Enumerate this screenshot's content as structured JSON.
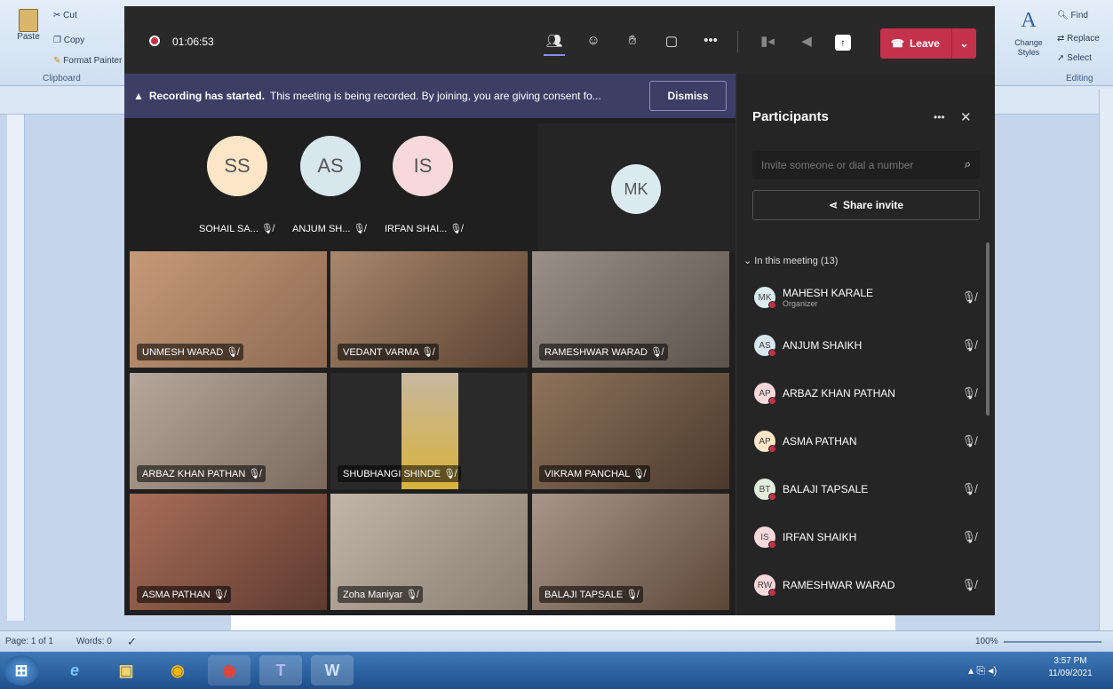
{
  "word": {
    "clipboard": {
      "paste": "Paste",
      "cut": "Cut",
      "copy": "Copy",
      "format_painter": "Format Painter",
      "label": "Clipboard"
    },
    "styles": {
      "change_styles": "Change Styles"
    },
    "editing": {
      "find": "Find",
      "replace": "Replace",
      "select": "Select",
      "label": "Editing"
    },
    "status": {
      "page": "Page: 1 of 1",
      "words": "Words: 0",
      "zoom": "100%"
    }
  },
  "taskbar": {
    "time": "3:57 PM",
    "date": "11/09/2021"
  },
  "teams": {
    "timer": "01:06:53",
    "leave_label": "Leave",
    "banner": {
      "title": "Recording has started.",
      "text": "This meeting is being recorded. By joining, you are giving consent fo...",
      "dismiss": "Dismiss"
    },
    "audio_tiles": [
      {
        "initials": "SS",
        "name": "SOHAIL SA...",
        "color": "#fde6c8"
      },
      {
        "initials": "AS",
        "name": "ANJUM SH...",
        "color": "#d8e6ee"
      },
      {
        "initials": "IS",
        "name": "IRFAN SHAI...",
        "color": "#f7d9dc"
      }
    ],
    "organizer_tile": {
      "initials": "MK",
      "color": "#dcebef"
    },
    "video_tiles": [
      {
        "name": "UNMESH WARAD",
        "bg": "#b58a6c"
      },
      {
        "name": "VEDANT VARMA",
        "bg": "#8e6d55"
      },
      {
        "name": "RAMESHWAR WARAD",
        "bg": "#7f756a"
      },
      {
        "name": "ARBAZ KHAN PATHAN",
        "bg": "#9c8c80"
      },
      {
        "name": "SHUBHANGI SHINDE",
        "bg": "#2a2a2a"
      },
      {
        "name": "VIKRAM PANCHAL",
        "bg": "#6e5745"
      },
      {
        "name": "ASMA PATHAN",
        "bg": "#8a5a48"
      },
      {
        "name": "Zoha Maniyar",
        "bg": "#a59a8e"
      },
      {
        "name": "BALAJI TAPSALE",
        "bg": "#7a6552"
      }
    ],
    "panel": {
      "title": "Participants",
      "invite_placeholder": "Invite someone or dial a number",
      "share_invite": "Share invite",
      "section": "In this meeting (13)",
      "participants": [
        {
          "initials": "MK",
          "name": "MAHESH KARALE",
          "role": "Organizer",
          "color": "#dcebef"
        },
        {
          "initials": "AS",
          "name": "ANJUM SHAIKH",
          "role": "",
          "color": "#d8e6ee"
        },
        {
          "initials": "AP",
          "name": "ARBAZ KHAN PATHAN",
          "role": "",
          "color": "#f7d9dc"
        },
        {
          "initials": "AP",
          "name": "ASMA PATHAN",
          "role": "",
          "color": "#fde6c8"
        },
        {
          "initials": "BT",
          "name": "BALAJI TAPSALE",
          "role": "",
          "color": "#e2eedd"
        },
        {
          "initials": "IS",
          "name": "IRFAN SHAIKH",
          "role": "",
          "color": "#f7d9dc"
        },
        {
          "initials": "RW",
          "name": "RAMESHWAR WARAD",
          "role": "",
          "color": "#f7d9dc"
        }
      ]
    }
  }
}
